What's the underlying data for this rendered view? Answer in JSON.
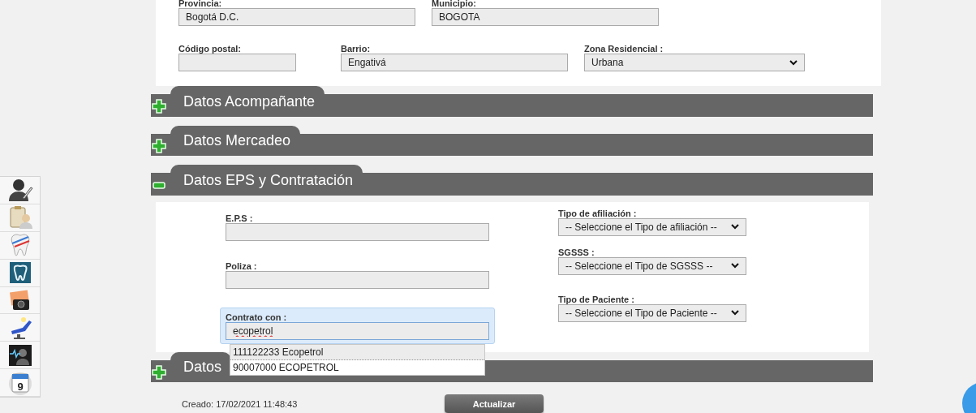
{
  "sidebar": {
    "calendar_day": "9"
  },
  "location": {
    "rows": [
      [
        {
          "label": "Provincia:",
          "value": "Bogotá D.C.",
          "kind": "input"
        },
        {
          "label": "Municipio:",
          "value": "BOGOTA",
          "kind": "input"
        }
      ],
      [
        {
          "label": "Código postal:",
          "kind": "input"
        },
        {
          "label": "Barrio:",
          "value": "Engativá",
          "kind": "input"
        },
        {
          "label": "Zona Residencial :",
          "value": "Urbana",
          "kind": "select"
        }
      ]
    ]
  },
  "sections": [
    {
      "title": "Datos Acompañante",
      "expanded": false
    },
    {
      "title": "Datos Mercadeo",
      "expanded": false
    },
    {
      "title": "Datos EPS y Contratación",
      "expanded": true,
      "left": [
        {
          "label": "E.P.S :",
          "kind": "input",
          "focused": false
        },
        {
          "label": "Poliza :",
          "kind": "input",
          "focused": false
        },
        {
          "label": "Contrato con :",
          "value": "ecopetrol",
          "kind": "autocomplete",
          "focused": true,
          "suggestions": [
            {
              "text": "111122233 Ecopetrol",
              "selected": true
            },
            {
              "text": "90007000 ECOPETROL",
              "selected": false
            }
          ]
        }
      ],
      "right": [
        {
          "label": "Tipo de afiliación :",
          "value": "-- Seleccione el Tipo de afiliación --",
          "kind": "select"
        },
        {
          "label": "SGSSS :",
          "value": "-- Seleccione el Tipo de SGSSS --",
          "kind": "select"
        },
        {
          "label": "Tipo de Paciente :",
          "value": "-- Seleccione el Tipo de Paciente --",
          "kind": "select"
        }
      ]
    },
    {
      "title": "Datos",
      "expanded": false
    }
  ],
  "footer": {
    "created": "Creado: 17/02/2021 11:48:43",
    "button": "Actualizar"
  }
}
